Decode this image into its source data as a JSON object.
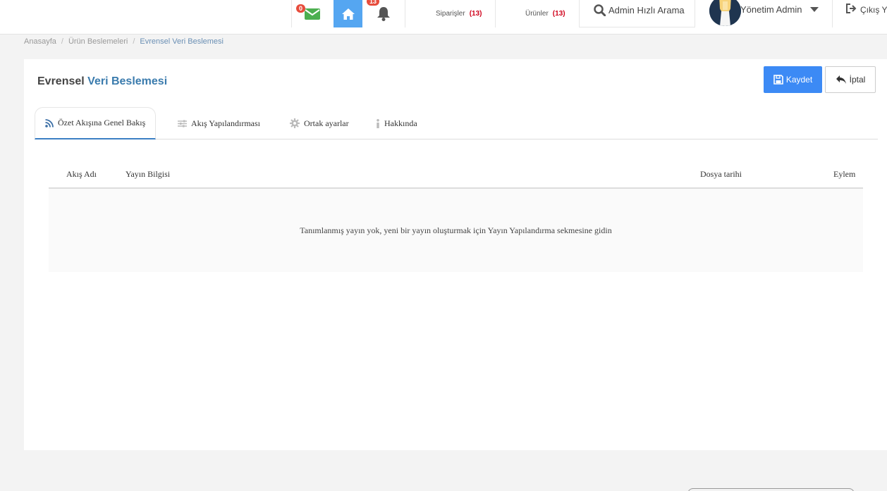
{
  "topbar": {
    "mail_badge": "0",
    "notif_badge": "13",
    "orders_label": "Siparişler",
    "orders_count": "(13)",
    "products_label": "Ürünler",
    "products_count": "(13)",
    "search_label": "Admin Hızlı Arama",
    "user_name": "Yönetim Admin",
    "logout_label": "Çıkış Y",
    "colors": {
      "mail": "#4caf50",
      "home_bg": "#55a6f1",
      "badge": "#e74c3c"
    }
  },
  "breadcrumb": {
    "items": [
      "Anasayfa",
      "Ürün Beslemeleri",
      "Evrensel Veri Beslemesi"
    ]
  },
  "page": {
    "title_part1": "Evrensel",
    "title_part2": "Veri Beslemesi",
    "save_label": "Kaydet",
    "cancel_label": "İptal"
  },
  "tabs": [
    {
      "label": "Özet Akışına Genel Bakış",
      "icon": "rss-icon"
    },
    {
      "label": "Akış Yapılandırması",
      "icon": "sliders-icon"
    },
    {
      "label": "Ortak ayarlar",
      "icon": "gear-icon"
    },
    {
      "label": "Hakkında",
      "icon": "info-icon"
    }
  ],
  "table": {
    "columns": [
      "Akış Adı",
      "Yayın Bilgisi",
      "Dosya tarihi",
      "Eylem"
    ],
    "empty_message": "Tanımlanmış yayın yok, yeni bir yayın oluşturmak için Yayın Yapılandırma sekmesine gidin"
  }
}
